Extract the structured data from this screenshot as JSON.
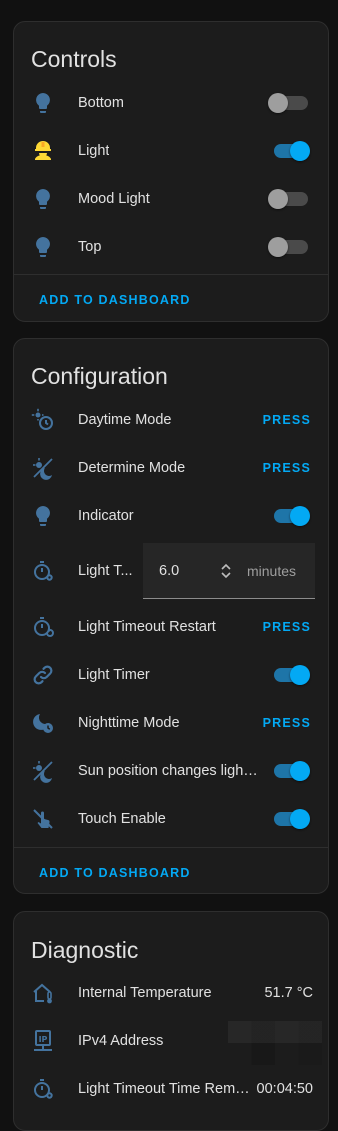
{
  "colors": {
    "accent": "#03a9f4",
    "icon": "#44739e",
    "card": "#1c1c1c",
    "background": "#111111"
  },
  "controls": {
    "title": "Controls",
    "items": [
      {
        "label": "Bottom",
        "icon": "lightbulb-icon",
        "state": "off"
      },
      {
        "label": "Light",
        "icon": "worker-helmet-icon",
        "state": "on"
      },
      {
        "label": "Mood Light",
        "icon": "lightbulb-icon",
        "state": "off"
      },
      {
        "label": "Top",
        "icon": "lightbulb-icon",
        "state": "off"
      }
    ],
    "footer": "ADD TO DASHBOARD"
  },
  "configuration": {
    "title": "Configuration",
    "items": [
      {
        "label": "Daytime Mode",
        "icon": "clock-sun-icon",
        "action": "PRESS"
      },
      {
        "label": "Determine Mode",
        "icon": "weather-sun-moon-icon",
        "action": "PRESS"
      },
      {
        "label": "Indicator",
        "icon": "lightbulb-icon",
        "state": "on"
      },
      {
        "label": "Light T...",
        "icon": "timer-cog-icon",
        "value": "6.0",
        "unit": "minutes"
      },
      {
        "label": "Light Timeout Restart",
        "icon": "timer-refresh-icon",
        "action": "PRESS"
      },
      {
        "label": "Light Timer",
        "icon": "link-icon",
        "state": "on"
      },
      {
        "label": "Nighttime Mode",
        "icon": "moon-clock-icon",
        "action": "PRESS"
      },
      {
        "label": "Sun position changes light ...",
        "icon": "weather-sun-moon-icon",
        "state": "on"
      },
      {
        "label": "Touch Enable",
        "icon": "gesture-tap-off-icon",
        "state": "on"
      }
    ],
    "footer": "ADD TO DASHBOARD"
  },
  "diagnostic": {
    "title": "Diagnostic",
    "items": [
      {
        "label": "Internal Temperature",
        "icon": "home-thermometer-icon",
        "value": "51.7 °C"
      },
      {
        "label": "IPv4 Address",
        "icon": "ip-network-icon",
        "value": ""
      },
      {
        "label": "Light Timeout Time Remai...",
        "icon": "timer-cog-icon",
        "value": "00:04:50"
      }
    ]
  }
}
